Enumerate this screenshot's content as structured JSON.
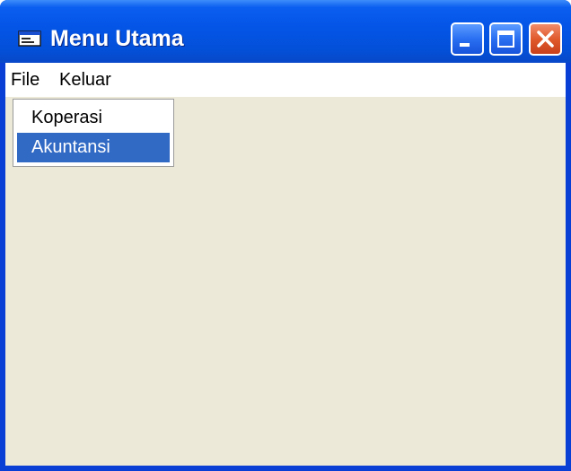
{
  "window": {
    "title": "Menu Utama",
    "icon": "form-icon"
  },
  "title_buttons": {
    "minimize": "minimize-icon",
    "maximize": "maximize-icon",
    "close": "close-icon"
  },
  "menubar": {
    "items": [
      {
        "label": "File"
      },
      {
        "label": "Keluar"
      }
    ]
  },
  "dropdown": {
    "items": [
      {
        "label": "Koperasi",
        "selected": false
      },
      {
        "label": "Akuntansi",
        "selected": true
      }
    ]
  },
  "colors": {
    "title_bar": "#0454e6",
    "client_bg": "#ece9d8",
    "selection": "#316ac5",
    "close_button": "#e05a2c"
  }
}
